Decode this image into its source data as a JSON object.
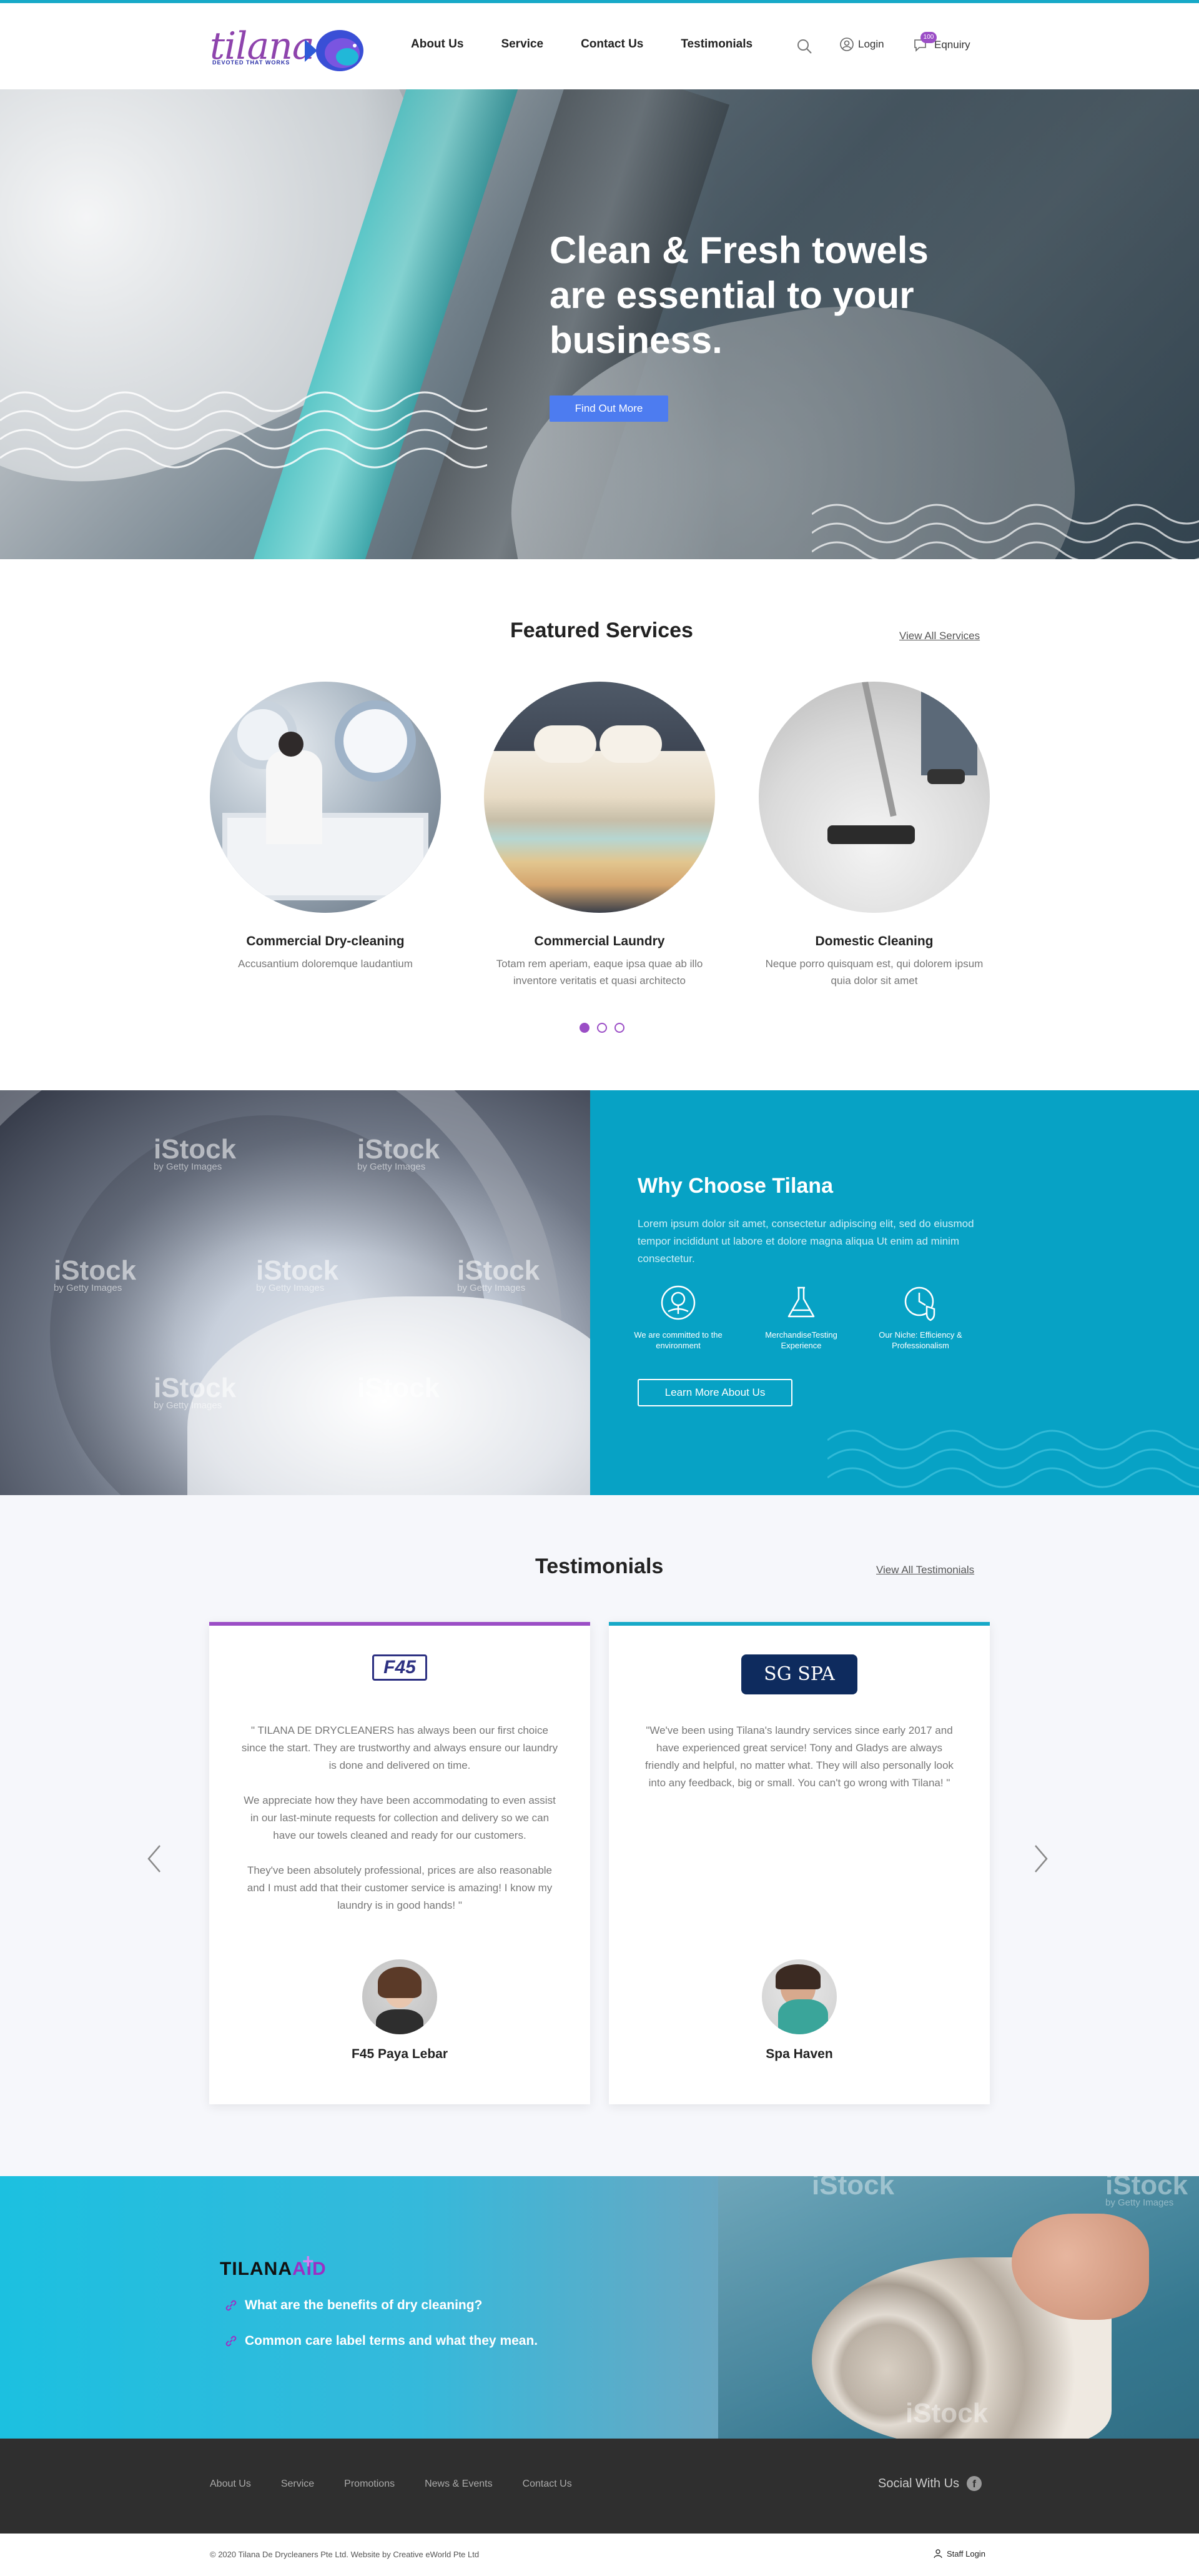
{
  "brand": {
    "name": "tilana",
    "tagline": "DEVOTED THAT WORKS"
  },
  "nav": {
    "items": [
      "About Us",
      "Service",
      "Contact Us",
      "Testimonials"
    ],
    "login": "Login",
    "enquiry": "Eqnuiry",
    "enquiry_badge": "100"
  },
  "hero": {
    "title": "Clean & Fresh towels are essential to your business.",
    "button": "Find Out More"
  },
  "featured": {
    "title": "Featured Services",
    "view_all": "View All Services",
    "services": [
      {
        "name": "Commercial Dry-cleaning",
        "desc": "Accusantium doloremque laudantium"
      },
      {
        "name": "Commercial Laundry",
        "desc": "Totam rem aperiam, eaque ipsa quae ab illo inventore veritatis et quasi architecto"
      },
      {
        "name": "Domestic Cleaning",
        "desc": "Neque porro quisquam est, qui dolorem ipsum quia dolor sit amet"
      }
    ],
    "slides": 3,
    "active_slide": 1
  },
  "why": {
    "title": "Why Choose Tilana",
    "text": "Lorem ipsum dolor sit amet, consectetur adipiscing elit, sed do eiusmod tempor incididunt ut labore et dolore magna aliqua Ut enim ad minim consectetur.",
    "features": [
      {
        "label": "We are committed to the environment",
        "icon": "tree-icon"
      },
      {
        "label": "MerchandiseTesting Experience",
        "icon": "flask-icon"
      },
      {
        "label": "Our Niche: Efficiency & Professionalism",
        "icon": "clock-shield-icon"
      }
    ],
    "button": "Learn More About Us"
  },
  "testimonials": {
    "title": "Testimonials",
    "view_all": "View All Testimonials",
    "items": [
      {
        "logo": "F45",
        "quote": [
          "\" TILANA DE DRYCLEANERS has always been our first choice since the start. They are trustworthy and always ensure our laundry is done and delivered on time.",
          "We appreciate how they have been accommodating to even assist in our last-minute requests for collection and delivery so we can have our towels cleaned and ready for our customers.",
          "They've been absolutely professional, prices are also reasonable and I must add that their customer service is amazing! I know my laundry is in good hands! \""
        ],
        "name": "F45 Paya Lebar",
        "accent": "#9b4ec6"
      },
      {
        "logo": "SG SPA",
        "quote": [
          "\"We've been using Tilana's laundry services since early 2017 and have experienced great service! Tony and Gladys are always friendly and helpful, no matter what. They will also personally look into any feedback, big or small. You can't go wrong with Tilana! \""
        ],
        "name": "Spa Haven",
        "accent": "#17a9c8"
      }
    ]
  },
  "aid": {
    "logo_main": "TILANA",
    "logo_accent": "AID",
    "links": [
      "What are the benefits of dry cleaning?",
      "Common care label terms and what they mean."
    ]
  },
  "footer": {
    "links": [
      "About Us",
      "Service",
      "Promotions",
      "News & Events",
      "Contact Us"
    ],
    "social": "Social With Us",
    "copyright": "© 2020 Tilana De Drycleaners Pte Ltd. Website by Creative eWorld Pte Ltd",
    "staff_login": "Staff Login"
  },
  "watermark": {
    "text": "iStock",
    "sub": "by Getty Images"
  },
  "colors": {
    "accent_teal": "#17a9c8",
    "accent_purple": "#9b4ec6",
    "button_blue": "#4d7cf0",
    "why_bg": "#07a2c5"
  }
}
